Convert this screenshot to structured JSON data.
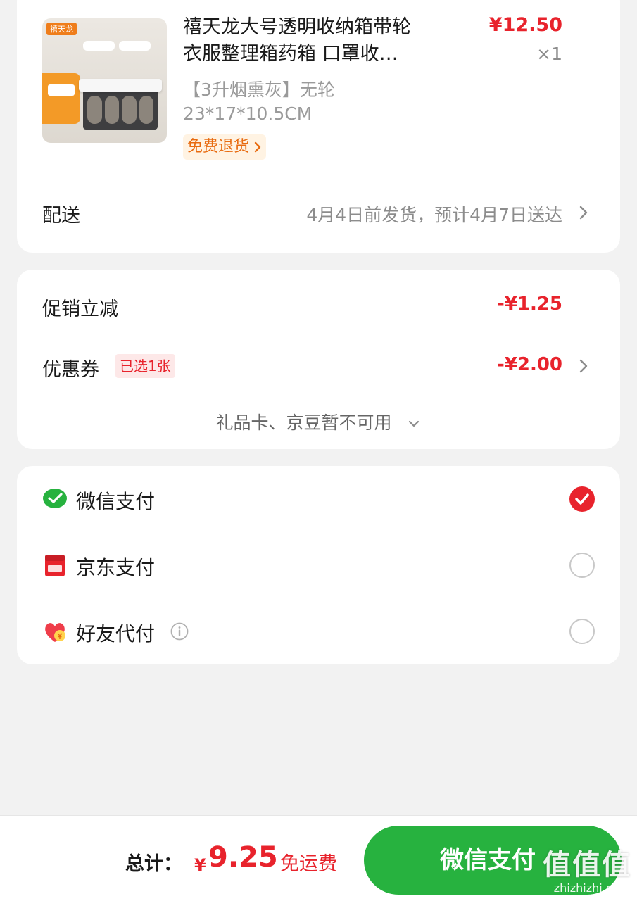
{
  "product": {
    "thumb_brand": "禧天龙",
    "title_line1": "禧天龙大号透明收纳箱带轮",
    "title_line2": "衣服整理箱药箱 口罩收…",
    "price": "¥12.50",
    "quantity": "×1",
    "spec_line1": "【3升烟熏灰】无轮",
    "spec_line2": "23*17*10.5CM",
    "return_badge": "免费退货"
  },
  "delivery": {
    "label": "配送",
    "value": "4月4日前发货，预计4月7日送达"
  },
  "discounts": {
    "promo_label": "促销立减",
    "promo_value": "-¥1.25",
    "coupon_label": "优惠券",
    "coupon_tag": "已选1张",
    "coupon_value": "-¥2.00",
    "giftcard_note": "礼品卡、京豆暂不可用"
  },
  "payment": {
    "methods": [
      {
        "label": "微信支付",
        "icon": "wechat-pay-icon",
        "selected": true
      },
      {
        "label": "京东支付",
        "icon": "jd-pay-icon",
        "selected": false
      },
      {
        "label": "好友代付",
        "icon": "friend-pay-icon",
        "selected": false
      }
    ]
  },
  "footer": {
    "total_label": "总计：",
    "currency": "¥",
    "total_amount": "9.25",
    "free_shipping": "免运费",
    "pay_button": "微信支付"
  },
  "watermark": {
    "text": "值值值",
    "url": "zhizhizhi.com"
  },
  "colors": {
    "accent_red": "#e8232c",
    "wechat_green": "#27b23f",
    "return_orange": "#e86b10"
  }
}
